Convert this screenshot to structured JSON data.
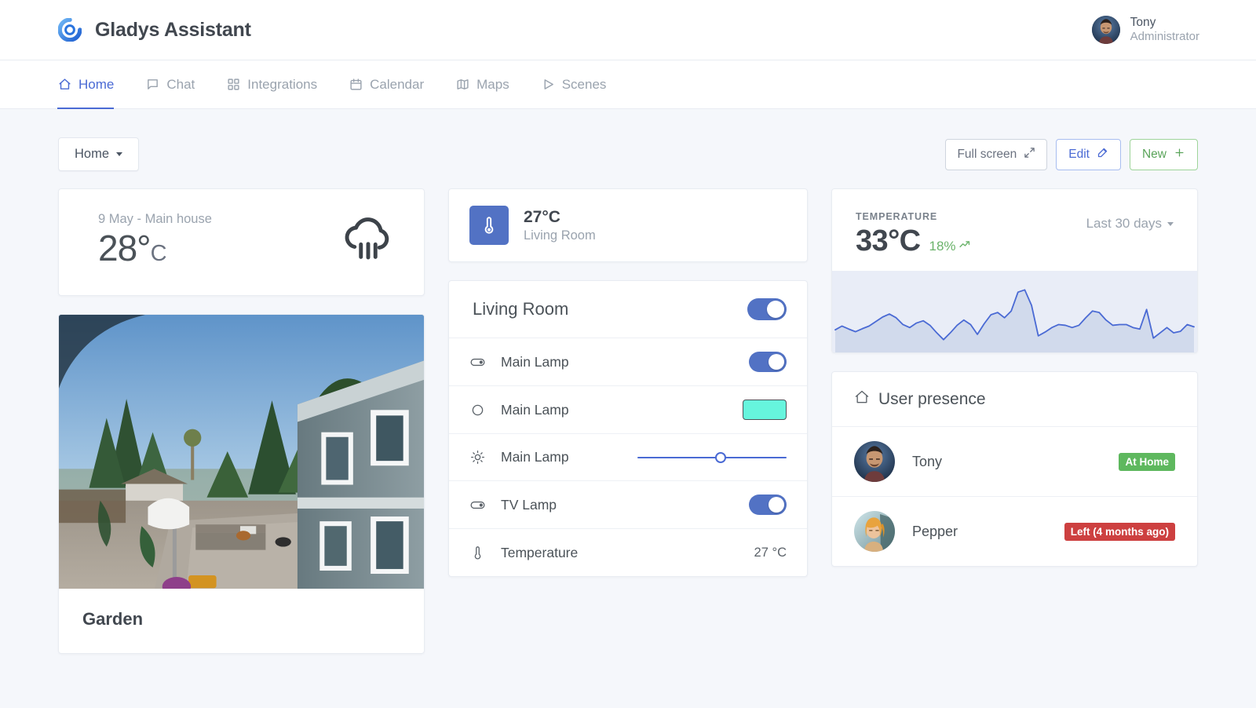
{
  "header": {
    "logo_icon": "gladys-ring-logo",
    "app_title": "Gladys Assistant",
    "user": {
      "name": "Tony",
      "role": "Administrator",
      "avatar_icon": "user-avatar-tony"
    }
  },
  "nav": {
    "items": [
      {
        "label": "Home",
        "icon": "home-icon",
        "active": true
      },
      {
        "label": "Chat",
        "icon": "chat-bubble-icon",
        "active": false
      },
      {
        "label": "Integrations",
        "icon": "grid-squares-icon",
        "active": false
      },
      {
        "label": "Calendar",
        "icon": "calendar-icon",
        "active": false
      },
      {
        "label": "Maps",
        "icon": "map-icon",
        "active": false
      },
      {
        "label": "Scenes",
        "icon": "play-triangle-icon",
        "active": false
      }
    ]
  },
  "toolbar": {
    "dashboard_label": "Home",
    "fullscreen_label": "Full screen",
    "edit_label": "Edit",
    "new_label": "New"
  },
  "weather": {
    "date_location": "9 May - Main house",
    "temperature": "28",
    "degree": "°",
    "unit": "C",
    "icon": "rain-cloud-icon"
  },
  "camera": {
    "name": "Garden",
    "image_alt": "backyard-camera-snapshot"
  },
  "sensor_tile": {
    "icon": "thermometer-icon",
    "value": "27°C",
    "room": "Living Room",
    "accent": "#5272c4"
  },
  "devices": {
    "room_title": "Living Room",
    "room_toggle_on": true,
    "rows": [
      {
        "icon": "toggle-switch-icon",
        "label": "Main Lamp",
        "control": "toggle",
        "value": "on"
      },
      {
        "icon": "circle-color-icon",
        "label": "Main Lamp",
        "control": "color",
        "value": "#66f5dd"
      },
      {
        "icon": "brightness-sun-icon",
        "label": "Main Lamp",
        "control": "slider",
        "value": "52"
      },
      {
        "icon": "toggle-switch-icon",
        "label": "TV Lamp",
        "control": "toggle",
        "value": "on"
      },
      {
        "icon": "thermometer-icon",
        "label": "Temperature",
        "control": "text",
        "value": "27 °C"
      }
    ]
  },
  "chart_card": {
    "kicker": "TEMPERATURE",
    "value": "33°C",
    "delta": "18%",
    "delta_icon": "trending-up-icon",
    "range_label": "Last 30 days",
    "range_icon": "chevron-down-icon"
  },
  "chart_data": {
    "type": "area",
    "title": "TEMPERATURE",
    "subtitle": "Last 30 days",
    "xlabel": "",
    "ylabel": "",
    "grid": false,
    "legend": false,
    "line_color": "#4a6ad4",
    "fill_color": "#ccd6ea",
    "background": "#e9edf7",
    "current_value": 33,
    "change_percent": 18,
    "ylim": [
      20,
      40
    ],
    "x": [
      1,
      2,
      3,
      4,
      5,
      6,
      7,
      8,
      9,
      10,
      11,
      12,
      13,
      14,
      15,
      16,
      17,
      18,
      19,
      20,
      21,
      22,
      23,
      24,
      25,
      26,
      27,
      28,
      29,
      30,
      31,
      32,
      33,
      34,
      35,
      36,
      37,
      38,
      39,
      40,
      41,
      42,
      43,
      44,
      45,
      46,
      47,
      48,
      49,
      50,
      51,
      52,
      53,
      54
    ],
    "values": [
      26,
      27,
      26.2,
      25.5,
      26.3,
      27,
      28.2,
      29.4,
      30.2,
      29.2,
      27.4,
      26.6,
      27.8,
      28.4,
      27.2,
      25.2,
      23.4,
      25.2,
      27.2,
      28.6,
      27.4,
      24.8,
      27.6,
      30,
      30.6,
      29.2,
      31,
      36,
      36.6,
      32.5,
      24.4,
      25.4,
      26.6,
      27.4,
      27.2,
      26.6,
      27.2,
      29.2,
      31,
      30.6,
      28.6,
      27.2,
      27.4,
      27.4,
      26.6,
      26.2,
      31.4,
      23.8,
      25.2,
      26.6,
      25.2,
      25.6,
      27.4,
      26.8
    ]
  },
  "presence": {
    "title": "User presence",
    "icon": "home-icon",
    "users": [
      {
        "name": "Tony",
        "status": "At Home",
        "status_color": "#5eb85e",
        "avatar_icon": "user-avatar-tony"
      },
      {
        "name": "Pepper",
        "status": "Left (4 months ago)",
        "status_color": "#cd4040",
        "avatar_icon": "user-avatar-pepper"
      }
    ]
  }
}
